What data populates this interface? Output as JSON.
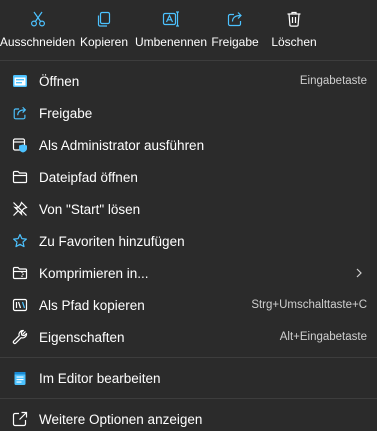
{
  "colors": {
    "background": "#2b2b2b",
    "text": "#ffffff",
    "shortcut_text": "#cfcfcf",
    "accent_icon": "#4cc2ff",
    "separator": "#3d3d3d"
  },
  "quick_actions": [
    {
      "label": "Ausschneiden",
      "icon": "scissors-icon"
    },
    {
      "label": "Kopieren",
      "icon": "copy-icon"
    },
    {
      "label": "Umbenennen",
      "icon": "rename-icon"
    },
    {
      "label": "Freigabe",
      "icon": "share-icon"
    },
    {
      "label": "Löschen",
      "icon": "trash-icon"
    }
  ],
  "items": [
    {
      "label": "Öffnen",
      "shortcut": "Eingabetaste",
      "icon": "open-icon"
    },
    {
      "label": "Freigabe",
      "shortcut": "",
      "icon": "share-icon"
    },
    {
      "label": "Als Administrator ausführen",
      "shortcut": "",
      "icon": "admin-shield-icon"
    },
    {
      "label": "Dateipfad öffnen",
      "shortcut": "",
      "icon": "folder-icon"
    },
    {
      "label": "Von \"Start\" lösen",
      "shortcut": "",
      "icon": "unpin-icon"
    },
    {
      "label": "Zu Favoriten hinzufügen",
      "shortcut": "",
      "icon": "star-icon"
    },
    {
      "label": "Komprimieren in...",
      "shortcut": "",
      "icon": "compress-folder-icon",
      "submenu": true
    },
    {
      "label": "Als Pfad kopieren",
      "shortcut": "Strg+Umschalttaste+C",
      "icon": "copy-path-icon"
    },
    {
      "label": "Eigenschaften",
      "shortcut": "Alt+Eingabetaste",
      "icon": "wrench-icon"
    },
    {
      "label": "Im Editor bearbeiten",
      "shortcut": "",
      "icon": "notepad-icon"
    },
    {
      "label": "Weitere Optionen anzeigen",
      "shortcut": "",
      "icon": "more-options-icon"
    }
  ]
}
